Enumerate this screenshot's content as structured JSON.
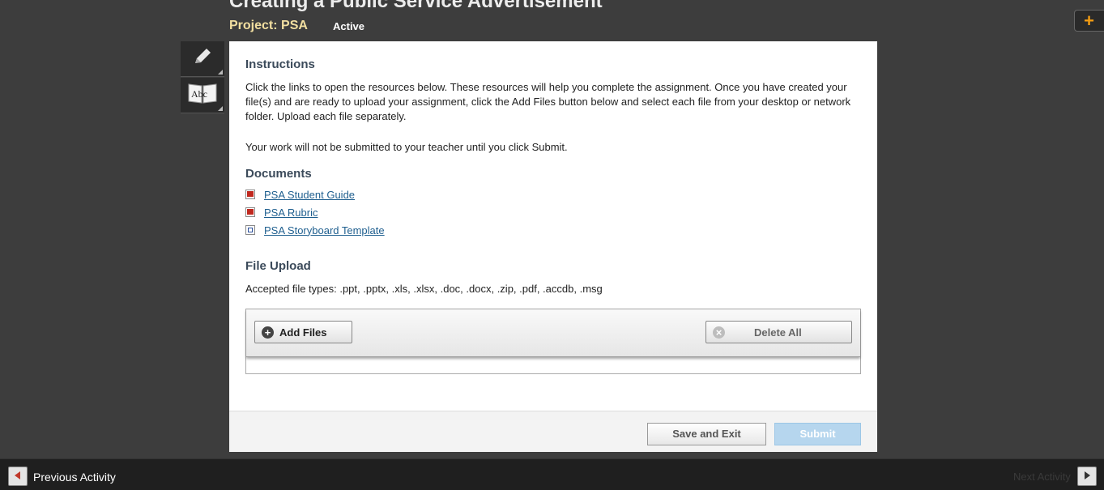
{
  "header": {
    "title": "Creating a Public Service Advertisement",
    "project": "Project: PSA",
    "status": "Active",
    "plus": "+"
  },
  "tools": [
    {
      "icon": "pencil-icon"
    },
    {
      "icon": "dictionary-icon",
      "glyph": "Abc"
    }
  ],
  "instructions": {
    "heading": "Instructions",
    "paragraph1": "Click the links to open the resources below. These resources will help you complete the assignment. Once you have created your file(s) and are ready to upload your assignment, click the Add Files button below and select each file from your desktop or network folder. Upload each file separately.",
    "paragraph2": "Your work will not be submitted to your teacher until you click Submit."
  },
  "documents": {
    "heading": "Documents",
    "items": [
      {
        "label": "PSA Student Guide",
        "icon": "pdf-icon"
      },
      {
        "label": "PSA Rubric",
        "icon": "pdf-icon"
      },
      {
        "label": "PSA Storyboard Template",
        "icon": "word-doc-icon"
      }
    ]
  },
  "file_upload": {
    "heading": "File Upload",
    "accepted": "Accepted file types: .ppt, .pptx, .xls, .xlsx, .doc, .docx, .zip, .pdf, .accdb, .msg",
    "add_files": "Add Files",
    "delete_all": "Delete All"
  },
  "actions": {
    "save_exit": "Save and Exit",
    "submit": "Submit"
  },
  "nav": {
    "previous": "Previous Activity",
    "next": "Next Activity"
  }
}
